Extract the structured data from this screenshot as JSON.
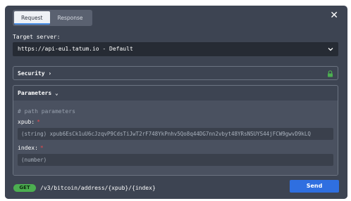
{
  "tabs": [
    {
      "label": "Request",
      "active": true
    },
    {
      "label": "Response",
      "active": false
    }
  ],
  "close_icon": "close-icon",
  "target_server": {
    "label": "Target server:",
    "value": "https://api-eu1.tatum.io - Default",
    "chevron": "chevron-down-icon"
  },
  "security": {
    "title": "Security",
    "title_suffix": "›",
    "lock_color": "#4caf50"
  },
  "parameters": {
    "title": "Parameters",
    "title_suffix": "⌄",
    "comment": "# path parameters",
    "fields": [
      {
        "name": "xpub:",
        "required": "*",
        "value": "(string) xpub6EsCk1uU6cJzqvP9CdsTiJwT2rF748YkPnhv5Qo8q44DG7nn2vbyt48YRsNSUYS44jFCW9gwvD9kLQ"
      },
      {
        "name": "index:",
        "required": "*",
        "value": "(number)"
      }
    ]
  },
  "footer": {
    "method": "GET",
    "method_color": "#4caf50",
    "path": "/v3/bitcoin/address/{xpub}/{index}",
    "send_label": "Send",
    "send_color": "#2f6fe0"
  }
}
